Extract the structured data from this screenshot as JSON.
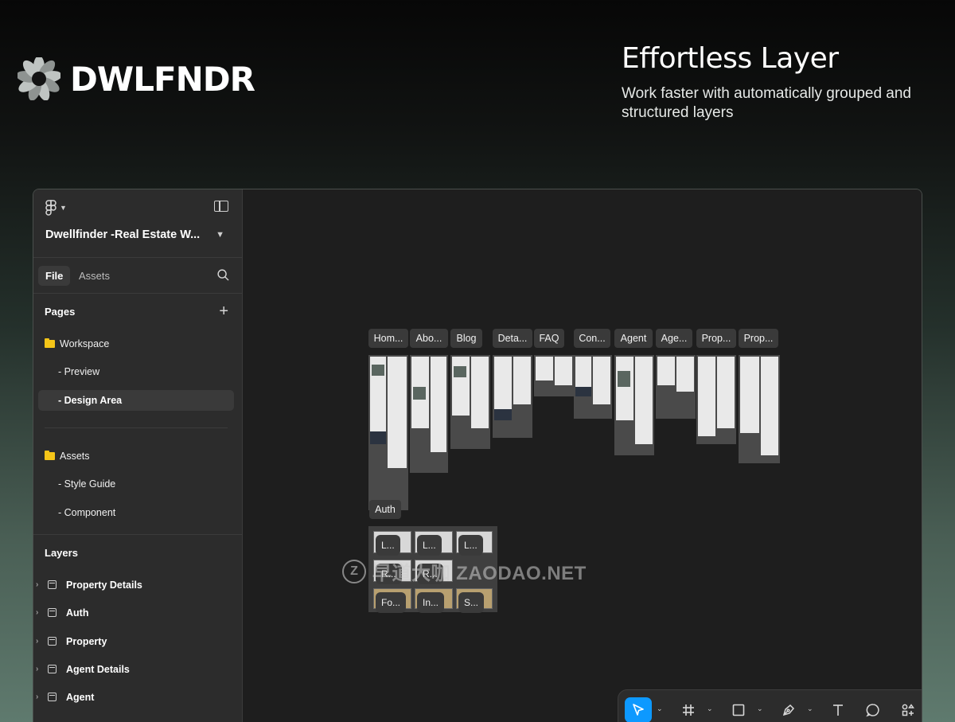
{
  "brand": {
    "name": "DWLFNDR",
    "logo_icon": "flower-logo-icon"
  },
  "hero": {
    "title": "Effortless Layer",
    "subtitle": "Work faster with automatically grouped and structured layers"
  },
  "sidebar": {
    "project_title": "Dwellfinder -Real Estate W...",
    "tabs": [
      "File",
      "Assets"
    ],
    "pages_heading": "Pages",
    "pages": [
      {
        "label": "Workspace",
        "type": "folder"
      },
      {
        "label": "- Preview",
        "type": "page"
      },
      {
        "label": "- Design Area",
        "type": "page",
        "selected": true
      },
      {
        "label": "Assets",
        "type": "folder"
      },
      {
        "label": "- Style Guide",
        "type": "page"
      },
      {
        "label": "- Component",
        "type": "page"
      }
    ],
    "layers_heading": "Layers",
    "layers": [
      "Property Details",
      "Auth",
      "Property",
      "Agent Details",
      "Agent"
    ]
  },
  "canvas": {
    "frame_labels": [
      "Hom...",
      "Abo...",
      "Blog",
      "Deta...",
      "FAQ",
      "Con...",
      "Agent",
      "Age...",
      "Prop...",
      "Prop..."
    ],
    "auth_label": "Auth",
    "auth_tile_labels": [
      "L...",
      "L...",
      "L...",
      "R...",
      "R...",
      "Fo...",
      "In...",
      "S..."
    ]
  },
  "watermark": {
    "text": "早道大咖 ZAODAO.NET",
    "mark": "Z"
  },
  "toolbar": {
    "tools": [
      "move-tool-icon",
      "frame-tool-icon",
      "rectangle-tool-icon",
      "pen-tool-icon",
      "text-tool-icon",
      "comment-tool-icon",
      "actions-tool-icon"
    ],
    "active_tool": "move-tool-icon",
    "dev_mode_icon": "code-icon",
    "accent_color": "#0d99ff"
  }
}
